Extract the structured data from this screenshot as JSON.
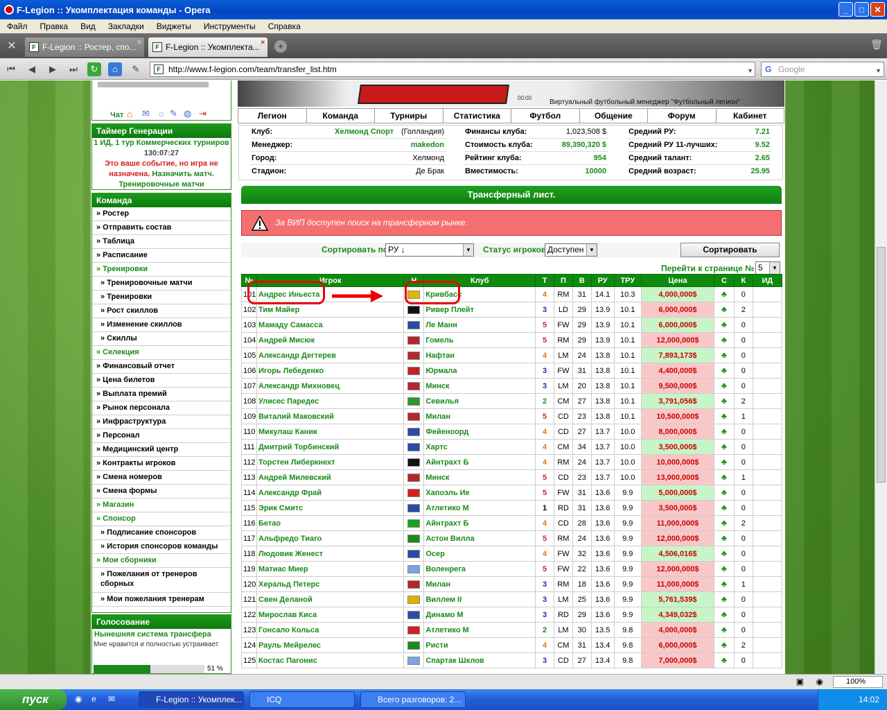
{
  "window": {
    "title": "F-Legion :: Укомплектация команды - Opera"
  },
  "menu": [
    "Файл",
    "Правка",
    "Вид",
    "Закладки",
    "Виджеты",
    "Инструменты",
    "Справка"
  ],
  "tabs": [
    {
      "label": "F-Legion :: Ростер, спо..."
    },
    {
      "label": "F-Legion :: Укомплекта..."
    }
  ],
  "nav": {
    "url": "http://www.f-legion.com/team/transfer_list.htm",
    "search_placeholder": "Google"
  },
  "header": {
    "banner_text": "Виртуальный футбольный менеджер \"Футбольный легион\"",
    "time_text": "00:00"
  },
  "topnav": [
    "Легион",
    "Команда",
    "Турниры",
    "Статистика",
    "Футбол",
    "Общение",
    "Форум",
    "Кабинет"
  ],
  "club_info": [
    {
      "label": "Клуб:",
      "value": "Хелмонд Спорт",
      "extra": "(Голландия)"
    },
    {
      "label": "Менеджер:",
      "value": "makedon"
    },
    {
      "label": "Город:",
      "value": "Хелмонд"
    },
    {
      "label": "Стадион:",
      "value": "Де Брак"
    }
  ],
  "club_stats": [
    {
      "label": "Финансы клуба:",
      "value": "1,023,508 $"
    },
    {
      "label": "Стоимость клуба:",
      "value": "89,390,320 $"
    },
    {
      "label": "Рейтинг клуба:",
      "value": "954"
    },
    {
      "label": "Вместимость:",
      "value": "10000"
    }
  ],
  "club_ratings": [
    {
      "label": "Средний РУ:",
      "value": "7.21"
    },
    {
      "label": "Средний РУ 11-лучших:",
      "value": "9.52"
    },
    {
      "label": "Средний талант:",
      "value": "2.65"
    },
    {
      "label": "Средний возраст:",
      "value": "25.95"
    }
  ],
  "sidebar": {
    "chat": "Чат",
    "timer_title": "Таймер Генерации",
    "timer_line1": "1 ИД, 1 тур Коммерческих турниров",
    "timer_time": "130:07:27",
    "event_red": "Это ваше событие, но игра не назначена.",
    "event_link": "Назначить матч.",
    "training_link": "Тренировочные матчи",
    "team_title": "Команда",
    "items": [
      {
        "label": "» Ростер",
        "type": "main"
      },
      {
        "label": "» Отправить состав",
        "type": "main"
      },
      {
        "label": "» Таблица",
        "type": "main"
      },
      {
        "label": "» Расписание",
        "type": "main"
      },
      {
        "label": "» Тренировки",
        "type": "green"
      },
      {
        "label": "» Тренировочные матчи",
        "type": "sub"
      },
      {
        "label": "» Тренировки",
        "type": "sub"
      },
      {
        "label": "» Рост скиллов",
        "type": "sub"
      },
      {
        "label": "» Изменение скиллов",
        "type": "sub"
      },
      {
        "label": "» Скиллы",
        "type": "sub"
      },
      {
        "label": "» Селекция",
        "type": "green"
      },
      {
        "label": "» Финансовый отчет",
        "type": "main"
      },
      {
        "label": "» Цена билетов",
        "type": "main"
      },
      {
        "label": "» Выплата премий",
        "type": "main"
      },
      {
        "label": "» Рынок персонала",
        "type": "main"
      },
      {
        "label": "» Инфраструктура",
        "type": "main"
      },
      {
        "label": "» Персонал",
        "type": "main"
      },
      {
        "label": "» Медицинский центр",
        "type": "main"
      },
      {
        "label": "» Контракты игроков",
        "type": "main"
      },
      {
        "label": "» Смена номеров",
        "type": "main"
      },
      {
        "label": "» Смена формы",
        "type": "main"
      },
      {
        "label": "» Магазин",
        "type": "green"
      },
      {
        "label": "» Спонсор",
        "type": "green"
      },
      {
        "label": "» Подписание спонсоров",
        "type": "sub"
      },
      {
        "label": "» История спонсоров команды",
        "type": "sub"
      },
      {
        "label": "» Мои сборники",
        "type": "green"
      },
      {
        "label": "» Пожелания от тренеров сборных",
        "type": "subtall"
      },
      {
        "label": "» Мои пожелания тренерам",
        "type": "sub"
      }
    ],
    "vote_title": "Голосование",
    "vote_question": "Нынешняя система трансфера",
    "vote_answer": "Мне нравится и полностью устраивает",
    "vote_percent_label": "51 %",
    "vote_percent": 0.51
  },
  "transfer": {
    "title": "Трансферный лист.",
    "vip_warning": "За ВИП доступен поиск на трансферном рынке.",
    "sort_label": "Сортировать по",
    "sort_value": "РУ ↓",
    "status_label": "Статус игроков",
    "status_value": "Доступен",
    "sort_button": "Сортировать",
    "goto_label": "Перейти к странице №",
    "goto_value": "5",
    "columns": [
      "№",
      "Игрок",
      "Н",
      "Клуб",
      "Т",
      "П",
      "В",
      "РУ",
      "ТРУ",
      "Цена",
      "С",
      "К",
      "ИД"
    ]
  },
  "players": [
    {
      "no": "101",
      "name": "Андрес Иньеста",
      "flag": "#e8b400",
      "club": "Кривбасс",
      "t": "4",
      "tcol": "#e07a00",
      "pos": "RM",
      "age": "31",
      "ru": "14.1",
      "tru": "10.3",
      "price": "4,000,000$",
      "pg": true,
      "k": "0"
    },
    {
      "no": "102",
      "name": "Тим Майер",
      "flag": "#111111",
      "club": "Ривер Плейт",
      "t": "3",
      "tcol": "#1a2ea8",
      "pos": "LD",
      "age": "29",
      "ru": "13.9",
      "tru": "10.1",
      "price": "6,000,000$",
      "pg": false,
      "k": "2"
    },
    {
      "no": "103",
      "name": "Мамаду Самасса",
      "flag": "#2a4aa8",
      "club": "Ле Манн",
      "t": "5",
      "tcol": "#d42020",
      "pos": "FW",
      "age": "29",
      "ru": "13.9",
      "tru": "10.1",
      "price": "6,000,000$",
      "pg": true,
      "k": "0"
    },
    {
      "no": "104",
      "name": "Андрей Мисюк",
      "flag": "#b5262a",
      "club": "Гомель",
      "t": "5",
      "tcol": "#d42020",
      "pos": "RM",
      "age": "29",
      "ru": "13.9",
      "tru": "10.1",
      "price": "12,000,000$",
      "pg": false,
      "k": "0"
    },
    {
      "no": "105",
      "name": "Александр Дегтерев",
      "flag": "#b5262a",
      "club": "Нафтан",
      "t": "4",
      "tcol": "#e07a00",
      "pos": "LM",
      "age": "24",
      "ru": "13.8",
      "tru": "10.1",
      "price": "7,893,173$",
      "pg": true,
      "k": "0"
    },
    {
      "no": "106",
      "name": "Игорь Лебеденко",
      "flag": "#c82020",
      "club": "Юрмала",
      "t": "3",
      "tcol": "#1a2ea8",
      "pos": "FW",
      "age": "31",
      "ru": "13.8",
      "tru": "10.1",
      "price": "4,400,000$",
      "pg": false,
      "k": "0"
    },
    {
      "no": "107",
      "name": "Александр Михновец",
      "flag": "#b5262a",
      "club": "Минск",
      "t": "3",
      "tcol": "#1a2ea8",
      "pos": "LM",
      "age": "20",
      "ru": "13.8",
      "tru": "10.1",
      "price": "9,500,000$",
      "pg": false,
      "k": "0"
    },
    {
      "no": "108",
      "name": "Улисес Паредес",
      "flag": "#2a9a2a",
      "club": "Севилья",
      "t": "2",
      "tcol": "#1a8a1a",
      "pos": "CM",
      "age": "27",
      "ru": "13.8",
      "tru": "10.1",
      "price": "3,791,056$",
      "pg": true,
      "k": "2"
    },
    {
      "no": "109",
      "name": "Виталий Маковский",
      "flag": "#b5262a",
      "club": "Милан",
      "t": "5",
      "tcol": "#d42020",
      "pos": "CD",
      "age": "23",
      "ru": "13.8",
      "tru": "10.1",
      "price": "10,500,000$",
      "pg": false,
      "k": "1"
    },
    {
      "no": "110",
      "name": "Микулаш Каник",
      "flag": "#2a4aa8",
      "club": "Фейеноорд",
      "t": "4",
      "tcol": "#e07a00",
      "pos": "CD",
      "age": "27",
      "ru": "13.7",
      "tru": "10.0",
      "price": "8,000,000$",
      "pg": false,
      "k": "0"
    },
    {
      "no": "111",
      "name": "Дмитрий Торбинский",
      "flag": "#2a4aa8",
      "club": "Хартс",
      "t": "4",
      "tcol": "#e07a00",
      "pos": "CM",
      "age": "34",
      "ru": "13.7",
      "tru": "10.0",
      "price": "3,500,000$",
      "pg": true,
      "k": "0"
    },
    {
      "no": "112",
      "name": "Торстен Либеркнехт",
      "flag": "#111111",
      "club": "Айнтрахт Б",
      "t": "4",
      "tcol": "#e07a00",
      "pos": "RM",
      "age": "24",
      "ru": "13.7",
      "tru": "10.0",
      "price": "10,000,000$",
      "pg": false,
      "k": "0"
    },
    {
      "no": "113",
      "name": "Андрей Милевский",
      "flag": "#b5262a",
      "club": "Минск",
      "t": "5",
      "tcol": "#d42020",
      "pos": "CD",
      "age": "23",
      "ru": "13.7",
      "tru": "10.0",
      "price": "13,000,000$",
      "pg": false,
      "k": "1"
    },
    {
      "no": "114",
      "name": "Александр Фрай",
      "flag": "#d42020",
      "club": "Хапоэль Ие",
      "t": "5",
      "tcol": "#d42020",
      "pos": "FW",
      "age": "31",
      "ru": "13.6",
      "tru": "9.9",
      "price": "5,000,000$",
      "pg": true,
      "k": "0"
    },
    {
      "no": "115",
      "name": "Эрик Смитс",
      "flag": "#2a4aa8",
      "club": "Атлетико М",
      "t": "1",
      "tcol": "#000000",
      "pos": "RD",
      "age": "31",
      "ru": "13.6",
      "tru": "9.9",
      "price": "3,500,000$",
      "pg": false,
      "k": "0"
    },
    {
      "no": "116",
      "name": "Бетао",
      "flag": "#1aa01a",
      "club": "Айнтрахт Б",
      "t": "4",
      "tcol": "#e07a00",
      "pos": "CD",
      "age": "28",
      "ru": "13.6",
      "tru": "9.9",
      "price": "11,000,000$",
      "pg": false,
      "k": "2"
    },
    {
      "no": "117",
      "name": "Альфредо Тиаго",
      "flag": "#1a8a1a",
      "club": "Астон Вилла",
      "t": "5",
      "tcol": "#d42020",
      "pos": "RM",
      "age": "24",
      "ru": "13.6",
      "tru": "9.9",
      "price": "12,000,000$",
      "pg": false,
      "k": "0"
    },
    {
      "no": "118",
      "name": "Людовик Женест",
      "flag": "#2a4aa8",
      "club": "Осер",
      "t": "4",
      "tcol": "#e07a00",
      "pos": "FW",
      "age": "32",
      "ru": "13.6",
      "tru": "9.9",
      "price": "4,506,016$",
      "pg": true,
      "k": "0"
    },
    {
      "no": "119",
      "name": "Матиас Миер",
      "flag": "#7aa6e0",
      "club": "Воленрега",
      "t": "5",
      "tcol": "#d42020",
      "pos": "FW",
      "age": "22",
      "ru": "13.6",
      "tru": "9.9",
      "price": "12,000,000$",
      "pg": false,
      "k": "0"
    },
    {
      "no": "120",
      "name": "Херальд Петерс",
      "flag": "#b5262a",
      "club": "Милан",
      "t": "3",
      "tcol": "#1a2ea8",
      "pos": "RM",
      "age": "18",
      "ru": "13.6",
      "tru": "9.9",
      "price": "11,000,000$",
      "pg": false,
      "k": "1"
    },
    {
      "no": "121",
      "name": "Свен Деланой",
      "flag": "#e0b000",
      "club": "Виллем II",
      "t": "3",
      "tcol": "#1a2ea8",
      "pos": "LM",
      "age": "25",
      "ru": "13.6",
      "tru": "9.9",
      "price": "5,761,539$",
      "pg": true,
      "k": "0"
    },
    {
      "no": "122",
      "name": "Мирослав Киса",
      "flag": "#2a4aa8",
      "club": "Динамо М",
      "t": "3",
      "tcol": "#1a2ea8",
      "pos": "RD",
      "age": "29",
      "ru": "13.6",
      "tru": "9.9",
      "price": "4,349,032$",
      "pg": true,
      "k": "0"
    },
    {
      "no": "123",
      "name": "Гонсало Кольса",
      "flag": "#d42020",
      "club": "Атлетико М",
      "t": "2",
      "tcol": "#1a8a1a",
      "pos": "LM",
      "age": "30",
      "ru": "13.5",
      "tru": "9.8",
      "price": "4,000,000$",
      "pg": false,
      "k": "0"
    },
    {
      "no": "124",
      "name": "Рауль Мейрелес",
      "flag": "#1a8a1a",
      "club": "Ристи",
      "t": "4",
      "tcol": "#e07a00",
      "pos": "CM",
      "age": "31",
      "ru": "13.4",
      "tru": "9.8",
      "price": "6,000,000$",
      "pg": false,
      "k": "2"
    },
    {
      "no": "125",
      "name": "Костас Пагонис",
      "flag": "#7aa6e0",
      "club": "Спартак Шклов",
      "t": "3",
      "tcol": "#1a2ea8",
      "pos": "CD",
      "age": "27",
      "ru": "13.4",
      "tru": "9.8",
      "price": "7,000,000$",
      "pg": false,
      "k": "0"
    }
  ],
  "statusbar": {
    "zoom": "100%"
  },
  "taskbar": {
    "start": "пуск",
    "items": [
      "F-Legion :: Укомплек...",
      "ICQ",
      "Всего разговоров: 2..."
    ],
    "clock": "14:02"
  },
  "colors": {
    "green": "#1a8a1a",
    "price_good": "#c8f5c8",
    "price_bad": "#f8c8c8",
    "annotation": "#e00000"
  }
}
